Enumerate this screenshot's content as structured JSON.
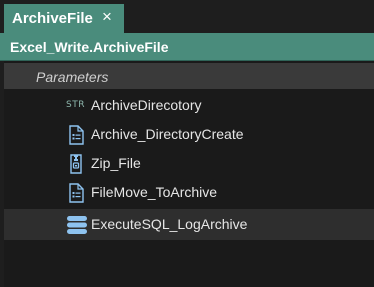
{
  "tab": {
    "title": "ArchiveFile",
    "close_glyph": "×"
  },
  "header": {
    "title": "Excel_Write.ArchiveFile"
  },
  "parameters": {
    "label": "Parameters"
  },
  "items": [
    {
      "label": "ArchiveDirecotory",
      "icon": "string-type-icon",
      "icon_text": "STR"
    },
    {
      "label": "Archive_DirectoryCreate",
      "icon": "document-list-icon"
    },
    {
      "label": "Zip_File",
      "icon": "zip-archive-icon"
    },
    {
      "label": "FileMove_ToArchive",
      "icon": "document-list-icon"
    },
    {
      "label": "ExecuteSQL_LogArchive",
      "icon": "database-icon"
    }
  ],
  "colors": {
    "accent": "#4a8c7c",
    "background": "#1e1e1e",
    "icon": "#8ec3f0"
  }
}
